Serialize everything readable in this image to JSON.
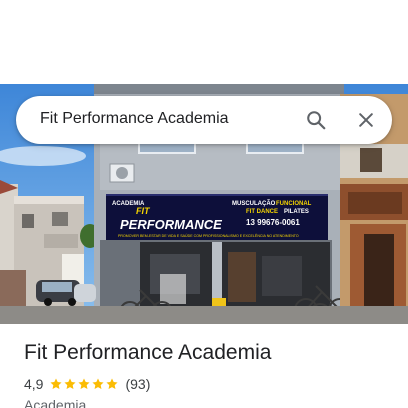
{
  "search": {
    "query": "Fit Performance Academia",
    "search_icon": "search-icon",
    "close_icon": "close-icon"
  },
  "place": {
    "name": "Fit Performance Academia",
    "rating": "4,9",
    "rating_stars": 5,
    "review_count": "(93)",
    "category": "Academia"
  },
  "photo": {
    "sign_brand": "ACADEMIA",
    "sign_main": "PERFORMANCE",
    "sign_services_line1": "MUSCULAÇÃO FUNCIONAL",
    "sign_services_line2": "FIT DANCE PILATES",
    "sign_phone": "13 99676-0061",
    "sign_slogan": "PROMOVER BEM-ESTAR DE VIDA E SAÚDE COM PROFISSIONALISMO E EXCELÊNCIA NO ATENDIMENTO"
  },
  "colors": {
    "star": "#fbbc04",
    "text_primary": "#202124",
    "text_secondary": "#5f6368",
    "sign_background": "#0d0f3a",
    "sign_yellow": "#f5d400"
  }
}
